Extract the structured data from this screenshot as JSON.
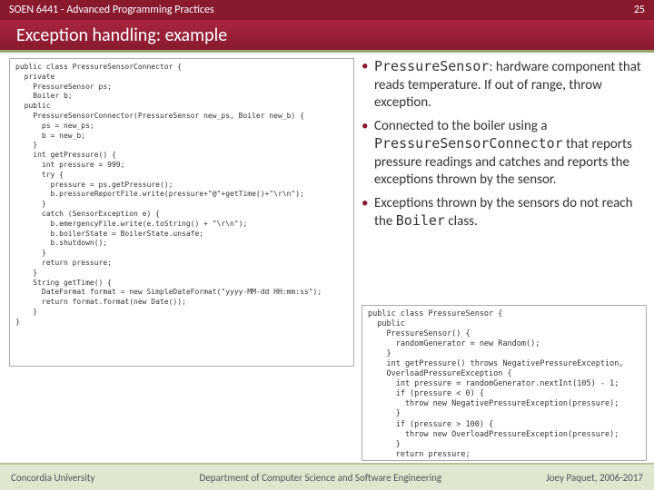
{
  "header": {
    "course": "SOEN 6441 - Advanced Programming Practices",
    "slide": "25"
  },
  "title": "Exception handling: example",
  "code1": "public class PressureSensorConnector {\n  private\n    PressureSensor ps;\n    Boiler b;\n  public\n    PressureSensorConnector(PressureSensor new_ps, Boiler new_b) {\n      ps = new_ps;\n      b = new_b;\n    }\n    int getPressure() {\n      int pressure = 999;\n      try {\n        pressure = ps.getPressure();\n        b.pressureReportFile.write(pressure+\"@\"+getTime()+\"\\r\\n\");\n      }\n      catch (SensorException e) {\n        b.emergencyFile.write(e.toString() + \"\\r\\n\");\n        b.boilerState = BoilerState.unsafe;\n        b.shutdown();\n      }\n      return pressure;\n    }\n    String getTime() {\n      DateFormat format = new SimpleDateFormat(\"yyyy-MM-dd HH:mm:ss\");\n      return format.format(new Date());\n    }\n}",
  "code2": "public class PressureSensor {\n  public\n    PressureSensor() {\n      randomGenerator = new Random();\n    }\n    int getPressure() throws NegativePressureException,\n    OverloadPressureException {\n      int pressure = randomGenerator.nextInt(105) - 1;\n      if (pressure < 0) {\n        throw new NegativePressureException(pressure);\n      }\n      if (pressure > 100) {\n        throw new OverloadPressureException(pressure);\n      }\n      return pressure;\n    }\n    Random randomGenerator;\n}",
  "bullets": {
    "b1_pre": "PressureSensor",
    "b1_post": ": hardware component that reads temperature. If out of range, throw exception.",
    "b2_pre": "Connected to the boiler using a ",
    "b2_mono": "PressureSensorConnector",
    "b2_post": " that reports pressure readings and catches and reports the exceptions thrown by the sensor.",
    "b3_pre": "Exceptions thrown by the sensors do not reach the ",
    "b3_mono": "Boiler",
    "b3_post": " class."
  },
  "footer": {
    "left": "Concordia University",
    "center": "Department of Computer Science and Software Engineering",
    "right": "Joey Paquet, 2006-2017"
  }
}
